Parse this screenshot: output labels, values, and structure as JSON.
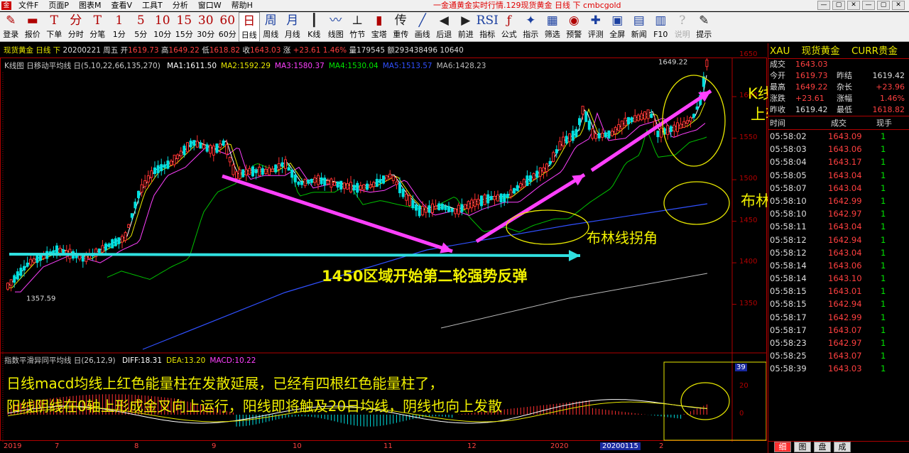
{
  "titlebar": {
    "menus": [
      "文件F",
      "页面P",
      "图表M",
      "查看V",
      "工具T",
      "分析",
      "窗口W",
      "帮助H"
    ],
    "title": "一金通黄金实时行情.129现货黄金 日线 下 cmbcgold",
    "buttons": [
      "—",
      "▢",
      "✕",
      "—",
      "▢",
      "✕"
    ]
  },
  "toolbar": [
    {
      "icon": "✎",
      "label": "登录",
      "name": "login"
    },
    {
      "icon": "▬",
      "label": "报价",
      "name": "quote"
    },
    {
      "icon": "T",
      "label": "下单",
      "name": "order"
    },
    {
      "icon": "分",
      "label": "分时",
      "name": "timeshare"
    },
    {
      "icon": "T",
      "label": "分笔",
      "name": "ticks"
    },
    {
      "icon": "1",
      "label": "1分",
      "name": "1min"
    },
    {
      "icon": "5",
      "label": "5分",
      "name": "5min"
    },
    {
      "icon": "10",
      "label": "10分",
      "name": "10min"
    },
    {
      "icon": "15",
      "label": "15分",
      "name": "15min"
    },
    {
      "icon": "30",
      "label": "30分",
      "name": "30min"
    },
    {
      "icon": "60",
      "label": "60分",
      "name": "60min"
    },
    {
      "icon": "日",
      "label": "日线",
      "name": "daily",
      "active": true
    },
    {
      "icon": "周",
      "label": "周线",
      "name": "weekly",
      "blue": true
    },
    {
      "icon": "月",
      "label": "月线",
      "name": "monthly",
      "blue": true
    },
    {
      "icon": "┃",
      "label": "K线",
      "name": "kline",
      "black": true
    },
    {
      "icon": "〰",
      "label": "线图",
      "name": "linechart",
      "blue": true
    },
    {
      "icon": "⊥",
      "label": "竹节",
      "name": "bamboo",
      "black": true
    },
    {
      "icon": "▮",
      "label": "宝塔",
      "name": "tower"
    },
    {
      "icon": "传",
      "label": "重传",
      "name": "reload",
      "black": true
    },
    {
      "icon": "╱",
      "label": "画线",
      "name": "draw",
      "blue": true
    },
    {
      "icon": "◀",
      "label": "后退",
      "name": "back",
      "black": true
    },
    {
      "icon": "▶",
      "label": "前进",
      "name": "forward",
      "black": true
    },
    {
      "icon": "RSI",
      "label": "指标",
      "name": "indicator",
      "blue": true
    },
    {
      "icon": "ƒ",
      "label": "公式",
      "name": "formula"
    },
    {
      "icon": "✦",
      "label": "指示",
      "name": "hint",
      "blue": true
    },
    {
      "icon": "▦",
      "label": "筛选",
      "name": "filter",
      "blue": true
    },
    {
      "icon": "◉",
      "label": "预警",
      "name": "alert"
    },
    {
      "icon": "✚",
      "label": "评测",
      "name": "evaluate",
      "blue": true
    },
    {
      "icon": "▣",
      "label": "全屏",
      "name": "fullscreen",
      "blue": true
    },
    {
      "icon": "▤",
      "label": "新闻",
      "name": "news",
      "blue": true
    },
    {
      "icon": "▥",
      "label": "F10",
      "name": "f10",
      "blue": true
    },
    {
      "icon": "?",
      "label": "说明",
      "name": "help",
      "disabled": true
    },
    {
      "icon": "✎",
      "label": "提示",
      "name": "tips",
      "black": true
    }
  ],
  "info": {
    "name": "现货黄金 日线 下",
    "date": "20200221 周五",
    "open_label": "开",
    "open": "1619.73",
    "high_label": "高",
    "high": "1649.22",
    "low_label": "低",
    "low": "1618.82",
    "close_label": "收",
    "close": "1643.03",
    "change_label": "涨",
    "change": "+23.61",
    "change_pct": "1.46%",
    "volume": "量179545",
    "amount": "额293438496",
    "oi": "10640"
  },
  "ma_legend": {
    "title": "K线图 日移动平均线 日(5,10,22,66,135,270)",
    "items": [
      {
        "text": "MA1:1611.50",
        "color": "#ffffff"
      },
      {
        "text": "MA2:1592.29",
        "color": "#e8e800"
      },
      {
        "text": "MA3:1580.37",
        "color": "#ff40ff"
      },
      {
        "text": "MA4:1530.04",
        "color": "#00e600"
      },
      {
        "text": "MA5:1513.57",
        "color": "#3050ff"
      },
      {
        "text": "MA6:1428.23",
        "color": "#bbbbbb"
      }
    ]
  },
  "macd_legend": {
    "title": "指数平滑异同平均线 日(26,12,9)",
    "items": [
      {
        "text": "DIFF:18.31",
        "color": "#ffffff"
      },
      {
        "text": "DEA:13.20",
        "color": "#e8e800"
      },
      {
        "text": "MACD:10.22",
        "color": "#ff40ff"
      }
    ]
  },
  "y_axis": [
    "1650",
    "1600",
    "1550",
    "1500",
    "1450",
    "1400",
    "1350"
  ],
  "macd_axis": [
    "39",
    "20",
    "0"
  ],
  "x_axis": [
    {
      "label": "2019",
      "pos": 5
    },
    {
      "label": "7",
      "pos": 77
    },
    {
      "label": "8",
      "pos": 189
    },
    {
      "label": "9",
      "pos": 298
    },
    {
      "label": "10",
      "pos": 412
    },
    {
      "label": "11",
      "pos": 540
    },
    {
      "label": "12",
      "pos": 658
    },
    {
      "label": "2020",
      "pos": 775
    },
    {
      "label": "20200115",
      "pos": 845,
      "highlight": true
    },
    {
      "label": "2",
      "pos": 928
    }
  ],
  "price_labels": {
    "high": "1649.22",
    "low": "1357.59"
  },
  "annotations": {
    "a1": "K线整体在布林线",
    "a2": "上轨运行",
    "a3": "布林线向上发散",
    "a4": "布林线拐角",
    "a5": "1450区域开始第二轮强势反弹",
    "a6": "日线macd均线上红色能量柱在发散延展，已经有四根红色能量柱了，",
    "a7": "阳线阴线在0轴上形成金叉向上运行，阳线即将触及20日均线，阴线也向上发散"
  },
  "rpanel": {
    "symbol": "XAU",
    "name": "现货黄金",
    "category": "CURR贵金",
    "quote_rows": [
      {
        "l1": "成交",
        "v1": "1643.03",
        "l2": "",
        "v2": "",
        "c1": "red",
        "c2": "white"
      },
      {
        "l1": "今开",
        "v1": "1619.73",
        "l2": "昨结",
        "v2": "1619.42",
        "c1": "red",
        "c2": "white"
      },
      {
        "l1": "最高",
        "v1": "1649.22",
        "l2": "杂长",
        "v2": "+23.96",
        "c1": "red",
        "c2": "red"
      },
      {
        "l1": "涨跌",
        "v1": "+23.61",
        "l2": "涨幅",
        "v2": "1.46%",
        "c1": "red",
        "c2": "red"
      },
      {
        "l1": "昨收",
        "v1": "1619.42",
        "l2": "最低",
        "v2": "1618.82",
        "c1": "white",
        "c2": "red"
      }
    ],
    "ticks_header": {
      "time": "时间",
      "price": "成交",
      "vol": "现手"
    },
    "ticks": [
      {
        "time": "05:58:02",
        "price": "1643.09",
        "vol": "1"
      },
      {
        "time": "05:58:03",
        "price": "1643.06",
        "vol": "1"
      },
      {
        "time": "05:58:04",
        "price": "1643.17",
        "vol": "1"
      },
      {
        "time": "05:58:05",
        "price": "1643.04",
        "vol": "1"
      },
      {
        "time": "05:58:07",
        "price": "1643.04",
        "vol": "1"
      },
      {
        "time": "05:58:10",
        "price": "1642.99",
        "vol": "1"
      },
      {
        "time": "05:58:10",
        "price": "1642.97",
        "vol": "1"
      },
      {
        "time": "05:58:11",
        "price": "1643.04",
        "vol": "1"
      },
      {
        "time": "05:58:12",
        "price": "1642.94",
        "vol": "1"
      },
      {
        "time": "05:58:12",
        "price": "1643.04",
        "vol": "1"
      },
      {
        "time": "05:58:14",
        "price": "1643.06",
        "vol": "1"
      },
      {
        "time": "05:58:14",
        "price": "1643.10",
        "vol": "1"
      },
      {
        "time": "05:58:15",
        "price": "1643.01",
        "vol": "1"
      },
      {
        "time": "05:58:15",
        "price": "1642.94",
        "vol": "1"
      },
      {
        "time": "05:58:17",
        "price": "1642.99",
        "vol": "1"
      },
      {
        "time": "05:58:17",
        "price": "1643.07",
        "vol": "1"
      },
      {
        "time": "05:58:23",
        "price": "1642.97",
        "vol": "1"
      },
      {
        "time": "05:58:25",
        "price": "1643.07",
        "vol": "1"
      },
      {
        "time": "05:58:39",
        "price": "1643.03",
        "vol": "1"
      }
    ],
    "tabs": [
      "细",
      "图",
      "盘",
      "成"
    ]
  },
  "colors": {
    "up": "#ff3030",
    "down": "#00e0e0",
    "arrow_magenta": "#ff40ff",
    "arrow_cyan": "#30e0e0",
    "annot_yellow": "#f0f000",
    "frame": "#b00000"
  }
}
